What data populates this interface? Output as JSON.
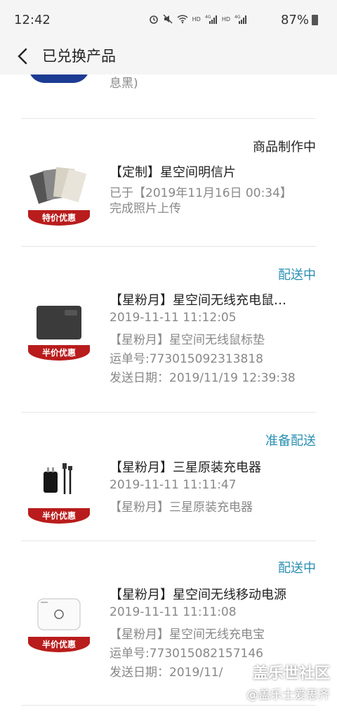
{
  "status_bar": {
    "time": "12:42",
    "battery": "87%",
    "icons": [
      "alarm-icon",
      "mute-icon",
      "wifi-icon",
      "hd-signal-icon",
      "4g-signal-icon",
      "hd-signal-icon",
      "4g-signal-icon",
      "battery-icon"
    ]
  },
  "header": {
    "back_label": "‹",
    "title": "已兑换产品"
  },
  "partial_item": {
    "text": "息黑)"
  },
  "orders": [
    {
      "status": "商品制作中",
      "status_color": "#222222",
      "badge": "特价优惠",
      "title": "【定制】星空间明信片",
      "lines": [
        "已于【2019年11月16日 00:34】",
        "完成照片上传"
      ]
    },
    {
      "status": "配送中",
      "status_color": "#2a8fb2",
      "badge": "半价优惠",
      "title": "【星粉月】星空间无线充电鼠…",
      "lines": [
        "2019-11-11 11:12:05",
        "【星粉月】星空间无线鼠标垫",
        "运单号:773015092313818",
        "发送日期：2019/11/19 12:39:38"
      ]
    },
    {
      "status": "准备配送",
      "status_color": "#2a8fb2",
      "badge": "半价优惠",
      "title": "【星粉月】三星原装充电器",
      "lines": [
        "2019-11-11 11:11:47",
        "【星粉月】三星原装充电器"
      ]
    },
    {
      "status": "配送中",
      "status_color": "#2a8fb2",
      "badge": "半价优惠",
      "title": "【星粉月】星空间无线移动电源",
      "lines": [
        "2019-11-11 11:11:08",
        "【星粉月】星空间无线充电宝",
        "运单号:773015082157146",
        "发送日期：2019/11/"
      ]
    }
  ],
  "watermark": {
    "main": "盖乐世社区",
    "sub": "@盖乐士爱思齐"
  }
}
